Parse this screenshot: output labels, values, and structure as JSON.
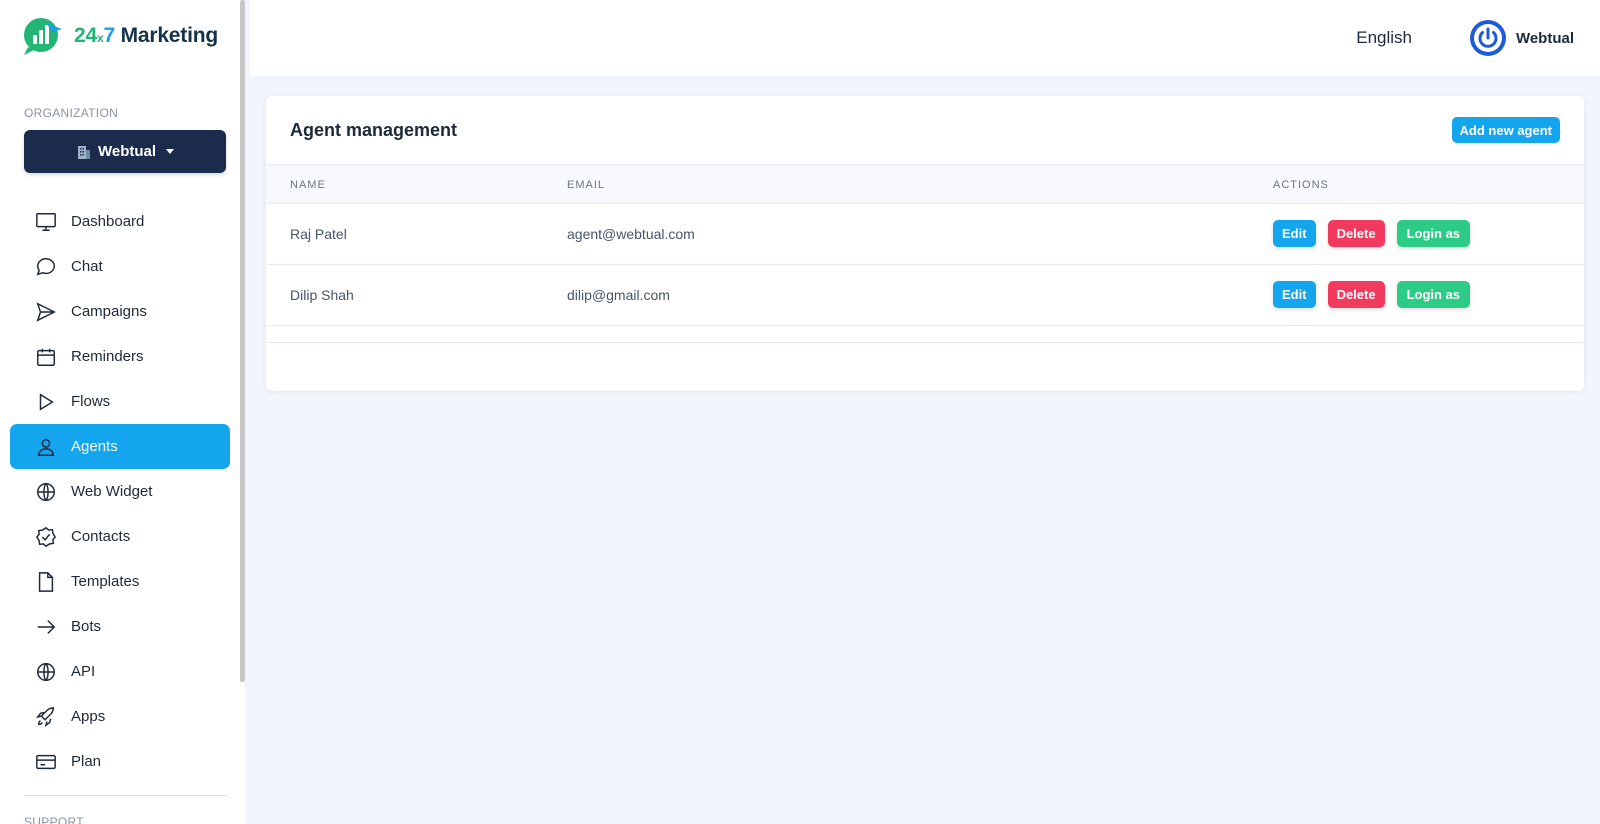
{
  "brand": {
    "n24": "24",
    "nx": "x",
    "n7": "7",
    "name": " Marketing"
  },
  "sidebar": {
    "org_label": "ORGANIZATION",
    "org_name": "Webtual",
    "items": [
      {
        "label": "Dashboard",
        "icon": "monitor-icon"
      },
      {
        "label": "Chat",
        "icon": "chat-bubble-icon"
      },
      {
        "label": "Campaigns",
        "icon": "send-icon"
      },
      {
        "label": "Reminders",
        "icon": "calendar-icon"
      },
      {
        "label": "Flows",
        "icon": "play-icon"
      },
      {
        "label": "Agents",
        "icon": "user-icon"
      },
      {
        "label": "Web Widget",
        "icon": "globe-icon"
      },
      {
        "label": "Contacts",
        "icon": "badge-check-icon"
      },
      {
        "label": "Templates",
        "icon": "file-icon"
      },
      {
        "label": "Bots",
        "icon": "arrow-right-icon"
      },
      {
        "label": "API",
        "icon": "globe-icon"
      },
      {
        "label": "Apps",
        "icon": "rocket-icon"
      },
      {
        "label": "Plan",
        "icon": "credit-card-icon"
      }
    ],
    "active_item": "Agents",
    "support_label": "SUPPORT"
  },
  "topbar": {
    "language": "English",
    "user_name": "Webtual"
  },
  "main": {
    "title": "Agent management",
    "add_button": "Add new agent",
    "columns": [
      "NAME",
      "EMAIL",
      "ACTIONS"
    ],
    "rows": [
      {
        "name": "Raj Patel",
        "email": "agent@webtual.com"
      },
      {
        "name": "Dilip Shah",
        "email": "dilip@gmail.com"
      }
    ],
    "actions": {
      "edit": "Edit",
      "delete": "Delete",
      "login": "Login as"
    }
  },
  "colors": {
    "accent": "#13a5ee",
    "danger": "#f23a5f",
    "success": "#2dcc86",
    "sidebar_dark": "#1b2b4b"
  }
}
